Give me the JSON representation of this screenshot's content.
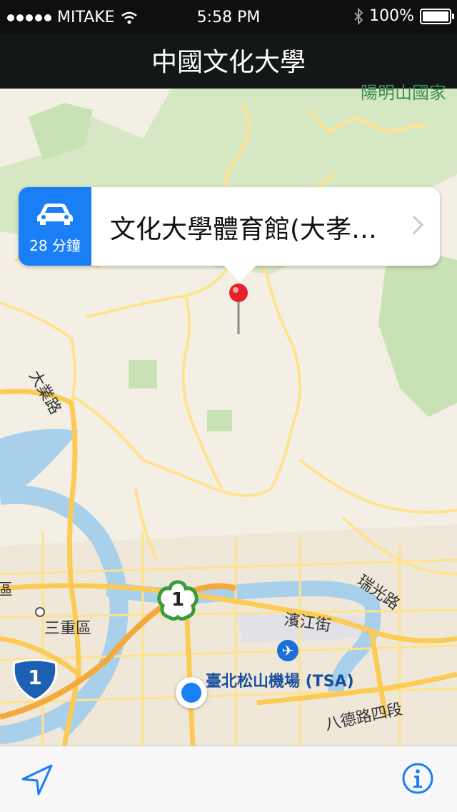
{
  "status_bar": {
    "carrier": "MITAKE",
    "time": "5:58 PM",
    "battery": "100%"
  },
  "nav": {
    "title": "中國文化大學"
  },
  "callout": {
    "eta": "28 分鐘",
    "title": "文化大學體育館(大孝…"
  },
  "map": {
    "labels": {
      "dayelu": "大業路",
      "sanchong": "三重區",
      "binjiang": "濱江街",
      "ruiguang": "瑞光路",
      "airport": "臺北松山機場 (TSA)",
      "bade": "八德路四段",
      "yangming": "陽明山國家",
      "qu_edge": "區"
    },
    "shields": {
      "provincial": "1",
      "national": "1"
    },
    "colors": {
      "land": "#f3efe4",
      "park": "#c9e2b5",
      "river": "#a9d0ea",
      "road": "#ffe28c",
      "major_road": "#fccb56",
      "accent": "#1a7ef7",
      "pin": "#e32229"
    }
  },
  "toolbar": {}
}
